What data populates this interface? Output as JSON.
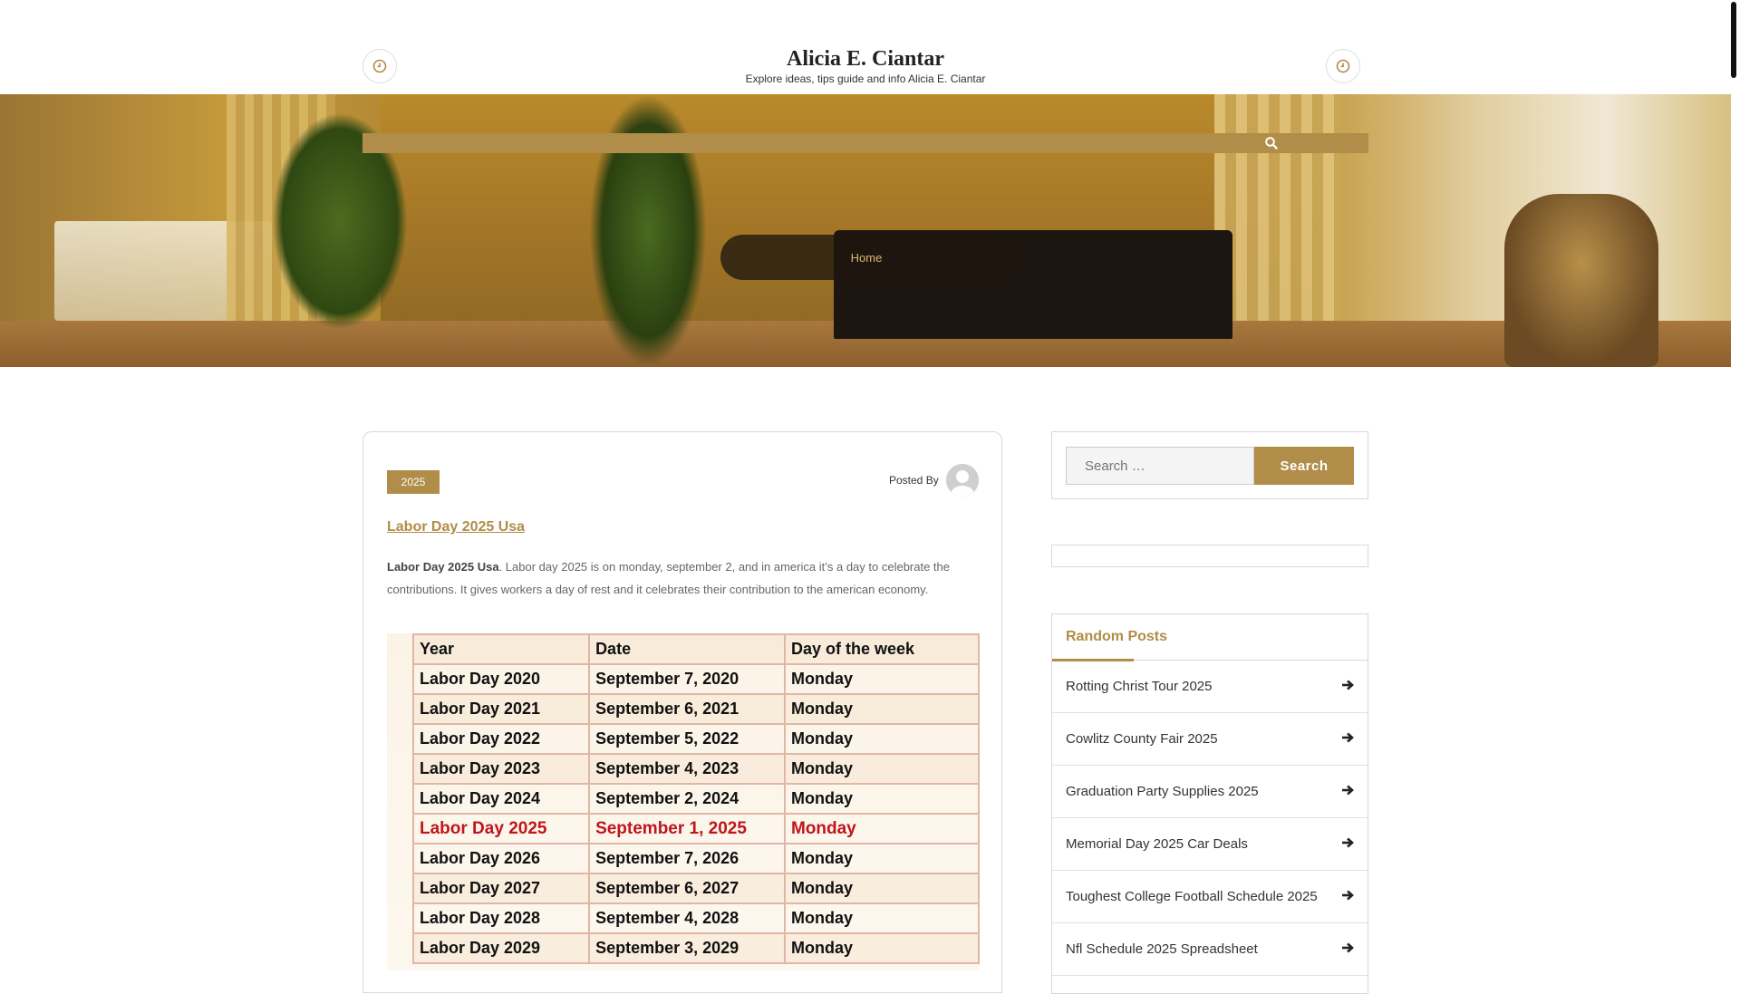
{
  "site": {
    "title": "Alicia E. Ciantar",
    "tagline": "Explore ideas, tips guide and info Alicia E. Ciantar"
  },
  "breadcrumb": {
    "home": "Home"
  },
  "post": {
    "category": "2025",
    "posted_by": "Posted By",
    "title": "Labor Day 2025 Usa",
    "excerpt_bold": "Labor Day 2025 Usa",
    "excerpt_text": ". Labor day 2025 is on monday, september 2, and in america it’s a day to celebrate the contributions. It gives workers a day of rest and it celebrates their contribution to the american economy.",
    "table": {
      "headers": [
        "Year",
        "Date",
        "Day of the week"
      ],
      "rows": [
        [
          "Labor Day 2020",
          "September 7, 2020",
          "Monday"
        ],
        [
          "Labor Day 2021",
          "September 6, 2021",
          "Monday"
        ],
        [
          "Labor Day 2022",
          "September 5, 2022",
          "Monday"
        ],
        [
          "Labor Day 2023",
          "September 4, 2023",
          "Monday"
        ],
        [
          "Labor Day 2024",
          "September 2, 2024",
          "Monday"
        ],
        [
          "Labor Day 2025",
          "September 1, 2025",
          "Monday"
        ],
        [
          "Labor Day 2026",
          "September 7, 2026",
          "Monday"
        ],
        [
          "Labor Day 2027",
          "September 6, 2027",
          "Monday"
        ],
        [
          "Labor Day 2028",
          "September 4, 2028",
          "Monday"
        ],
        [
          "Labor Day 2029",
          "September 3, 2029",
          "Monday"
        ]
      ],
      "highlight_row": 5,
      "highlight_color": "#c0151c"
    }
  },
  "sidebar": {
    "search": {
      "placeholder": "Search …",
      "button": "Search"
    },
    "random_posts": {
      "title": "Random Posts",
      "items": [
        "Rotting Christ Tour 2025",
        "Cowlitz County Fair 2025",
        "Graduation Party Supplies 2025",
        "Memorial Day 2025 Car Deals",
        "Toughest College Football Schedule 2025",
        "Nfl Schedule 2025 Spreadsheet"
      ]
    }
  },
  "colors": {
    "accent": "#b08d48",
    "hero_overlay": "#1e160e"
  },
  "icons": {
    "left_header": "clock-icon",
    "right_header": "clock-icon",
    "nav_search": "search-icon",
    "list_arrow": "arrow-circle-right-icon"
  }
}
